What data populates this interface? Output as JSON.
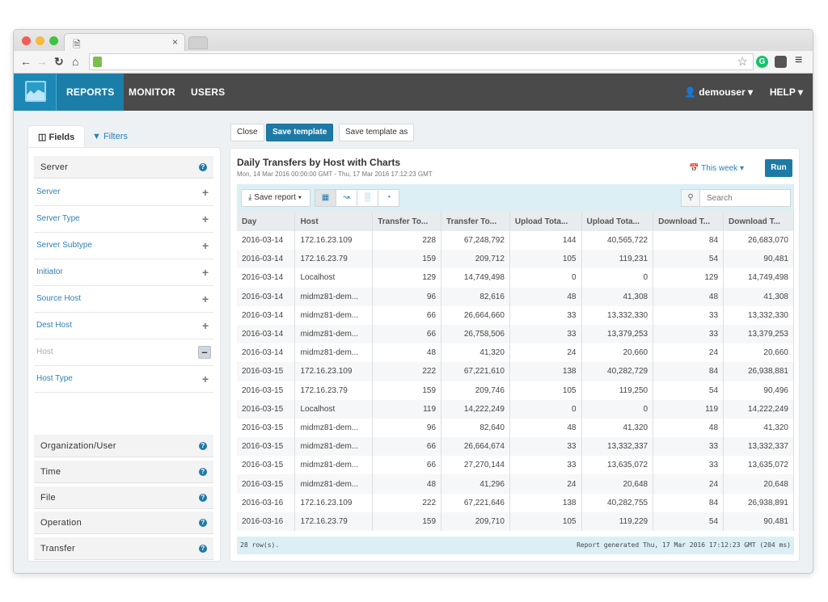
{
  "browser": {
    "tab_close": "×",
    "url": ""
  },
  "app": {
    "nav": [
      "REPORTS",
      "MONITOR",
      "USERS"
    ],
    "user": "demouser",
    "help": "HELP",
    "colors": {
      "accent": "#1d7aa6",
      "header": "#4a4a4a",
      "logo_bg": "#1d87b5"
    }
  },
  "left": {
    "tabs": [
      "Fields",
      "Filters"
    ],
    "groups_top": [
      {
        "label": "Server"
      }
    ],
    "fields": [
      {
        "label": "Server",
        "state": "add"
      },
      {
        "label": "Server Type",
        "state": "add"
      },
      {
        "label": "Server Subtype",
        "state": "add"
      },
      {
        "label": "Initiator",
        "state": "add"
      },
      {
        "label": "Source Host",
        "state": "add"
      },
      {
        "label": "Dest Host",
        "state": "add"
      },
      {
        "label": "Host",
        "state": "remove"
      },
      {
        "label": "Host Type",
        "state": "add"
      }
    ],
    "groups_bottom": [
      "Organization/User",
      "Time",
      "File",
      "Operation",
      "Transfer"
    ]
  },
  "actions": {
    "close": "Close",
    "save_template": "Save template",
    "save_template_as": "Save template as"
  },
  "report": {
    "title": "Daily Transfers by Host with Charts",
    "subtitle": "Mon, 14 Mar 2016 00:00:00 GMT - Thu, 17 Mar 2016 17:12:23 GMT",
    "range": "This week",
    "run": "Run",
    "save_report": "Save report",
    "views": [
      "table-view",
      "line-chart",
      "bar-chart",
      "pie-chart"
    ],
    "search_placeholder": "Search",
    "columns": [
      "Day",
      "Host",
      "Transfer To...",
      "Transfer To...",
      "Upload Tota...",
      "Upload Tota...",
      "Download T...",
      "Download T..."
    ],
    "rows": [
      [
        "2016-03-14",
        "172.16.23.109",
        "228",
        "67,248,792",
        "144",
        "40,565,722",
        "84",
        "26,683,070"
      ],
      [
        "2016-03-14",
        "172.16.23.79",
        "159",
        "209,712",
        "105",
        "119,231",
        "54",
        "90,481"
      ],
      [
        "2016-03-14",
        "Localhost",
        "129",
        "14,749,498",
        "0",
        "0",
        "129",
        "14,749,498"
      ],
      [
        "2016-03-14",
        "midmz81-dem...",
        "96",
        "82,616",
        "48",
        "41,308",
        "48",
        "41,308"
      ],
      [
        "2016-03-14",
        "midmz81-dem...",
        "66",
        "26,664,660",
        "33",
        "13,332,330",
        "33",
        "13,332,330"
      ],
      [
        "2016-03-14",
        "midmz81-dem...",
        "66",
        "26,758,506",
        "33",
        "13,379,253",
        "33",
        "13,379,253"
      ],
      [
        "2016-03-14",
        "midmz81-dem...",
        "48",
        "41,320",
        "24",
        "20,660",
        "24",
        "20,660"
      ],
      [
        "2016-03-15",
        "172.16.23.109",
        "222",
        "67,221,610",
        "138",
        "40,282,729",
        "84",
        "26,938,881"
      ],
      [
        "2016-03-15",
        "172.16.23.79",
        "159",
        "209,746",
        "105",
        "119,250",
        "54",
        "90,496"
      ],
      [
        "2016-03-15",
        "Localhost",
        "119",
        "14,222,249",
        "0",
        "0",
        "119",
        "14,222,249"
      ],
      [
        "2016-03-15",
        "midmz81-dem...",
        "96",
        "82,640",
        "48",
        "41,320",
        "48",
        "41,320"
      ],
      [
        "2016-03-15",
        "midmz81-dem...",
        "66",
        "26,664,674",
        "33",
        "13,332,337",
        "33",
        "13,332,337"
      ],
      [
        "2016-03-15",
        "midmz81-dem...",
        "66",
        "27,270,144",
        "33",
        "13,635,072",
        "33",
        "13,635,072"
      ],
      [
        "2016-03-15",
        "midmz81-dem...",
        "48",
        "41,296",
        "24",
        "20,648",
        "24",
        "20,648"
      ],
      [
        "2016-03-16",
        "172.16.23.109",
        "222",
        "67,221,646",
        "138",
        "40,282,755",
        "84",
        "26,938,891"
      ],
      [
        "2016-03-16",
        "172.16.23.79",
        "159",
        "209,710",
        "105",
        "119,229",
        "54",
        "90,481"
      ]
    ],
    "footer_rows": "28 row(s).",
    "footer_generated": "Report generated Thu, 17 Mar 2016 17:12:23 GMT (204 ms)"
  }
}
